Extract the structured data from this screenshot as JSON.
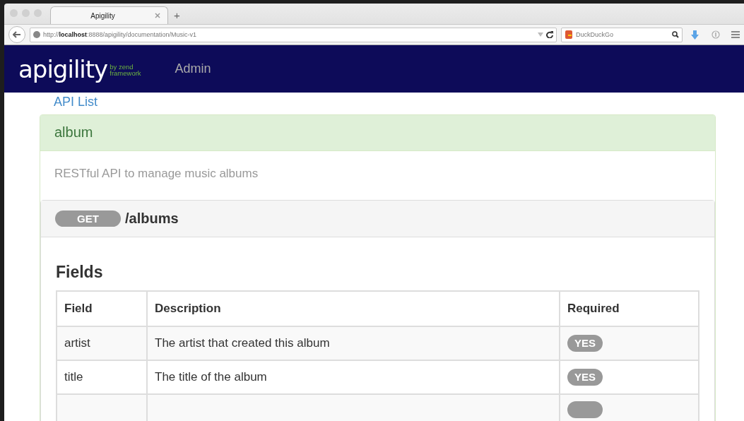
{
  "browser": {
    "tab_title": "Apigility",
    "new_tab": "+",
    "url_prefix": "http://",
    "url_host": "localhost",
    "url_rest": ":8888/apigility/documentation/Music-v1",
    "search_engine": "DuckDuckGo"
  },
  "navbar": {
    "logo": "apigility",
    "logo_by": "by zend",
    "logo_framework": "framework",
    "link": "Admin"
  },
  "breadcrumb": "API List",
  "service": {
    "name": "album",
    "description": "RESTful API to manage music albums",
    "operation": {
      "method": "GET",
      "path": "/albums"
    },
    "fields_title": "Fields",
    "columns": [
      "Field",
      "Description",
      "Required"
    ],
    "rows": [
      {
        "field": "artist",
        "description": "The artist that created this album",
        "required": "YES"
      },
      {
        "field": "title",
        "description": "The title of the album",
        "required": "YES"
      },
      {
        "partial": true
      }
    ]
  }
}
